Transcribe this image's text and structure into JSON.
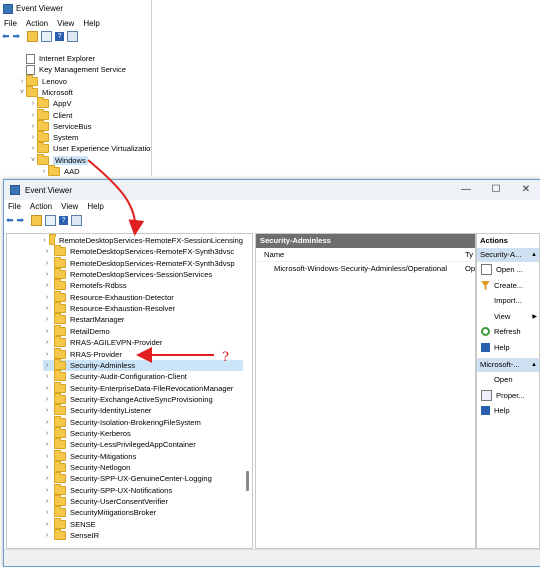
{
  "back_window": {
    "title": "Event Viewer",
    "menu": [
      "File",
      "Action",
      "View",
      "Help"
    ],
    "tree": [
      {
        "label": "Internet Explorer",
        "type": "log",
        "chev": ""
      },
      {
        "label": "Key Management Service",
        "type": "log",
        "chev": ""
      },
      {
        "label": "Lenovo",
        "type": "folder",
        "chev": "›"
      },
      {
        "label": "Microsoft",
        "type": "folder",
        "chev": "˅"
      },
      {
        "label": "AppV",
        "type": "folder",
        "chev": "›"
      },
      {
        "label": "Client",
        "type": "folder",
        "chev": "›"
      },
      {
        "label": "ServiceBus",
        "type": "folder",
        "chev": "›"
      },
      {
        "label": "System",
        "type": "folder",
        "chev": "›"
      },
      {
        "label": "User Experience Virtualization",
        "type": "folder",
        "chev": "›"
      },
      {
        "label": "Windows",
        "type": "folder",
        "chev": "˅",
        "selected": true
      },
      {
        "label": "AAD",
        "type": "folder",
        "chev": "›"
      }
    ]
  },
  "front_window": {
    "title": "Event Viewer",
    "menu": [
      "File",
      "Action",
      "View",
      "Help"
    ],
    "window_buttons": [
      "—",
      "☐",
      "✕"
    ],
    "tree": [
      "RemoteDesktopServices-RemoteFX-SessionLicensing",
      "RemoteDesktopServices-RemoteFX-Synth3dvsc",
      "RemoteDesktopServices-RemoteFX-Synth3dvsp",
      "RemoteDesktopServices-SessionServices",
      "Remotefs-Rdbss",
      "Resource-Exhaustion-Detector",
      "Resource-Exhaustion-Resolver",
      "RestartManager",
      "RetailDemo",
      "RRAS-AGILEVPN-Provider",
      "RRAS-Provider",
      "Security-Adminless",
      "Security-Audit-Configuration-Client",
      "Security-EnterpriseData-FileRevocationManager",
      "Security-ExchangeActiveSyncProvisioning",
      "Security-IdentityListener",
      "Security-Isolation-BrokeringFileSystem",
      "Security-Kerberos",
      "Security-LessPrivilegedAppContainer",
      "Security-Mitigations",
      "Security-Netlogon",
      "Security-SPP-UX-GenuineCenter-Logging",
      "Security-SPP-UX-Notifications",
      "Security-UserConsentVerifier",
      "SecurityMitigationsBroker",
      "SENSE",
      "SenseIR"
    ],
    "selected_index": 11,
    "middle": {
      "header": "Security-Adminless",
      "col_name": "Name",
      "col_type": "Ty",
      "row_name": "Microsoft-Windows-Security-Adminless/Operational",
      "row_type": "Op"
    },
    "actions": {
      "header": "Actions",
      "section1": "Security-A...",
      "items1": [
        {
          "label": "Open ...",
          "icon": "open-log-icon"
        },
        {
          "label": "Create...",
          "icon": "filter-icon"
        },
        {
          "label": "Import...",
          "icon": ""
        },
        {
          "label": "View",
          "icon": "",
          "arrow": "▶"
        },
        {
          "label": "Refresh",
          "icon": "refresh-icon"
        },
        {
          "label": "Help",
          "icon": "help-icon"
        }
      ],
      "section2": "Microsoft-...",
      "items2": [
        {
          "label": "Open",
          "icon": ""
        },
        {
          "label": "Proper...",
          "icon": "properties-icon"
        },
        {
          "label": "Help",
          "icon": "help-icon"
        }
      ]
    }
  },
  "annotation": {
    "question_mark": "?"
  },
  "colors": {
    "selection": "#cce4f7",
    "arrow": "#e02020",
    "action_section": "#cfe0f2"
  }
}
